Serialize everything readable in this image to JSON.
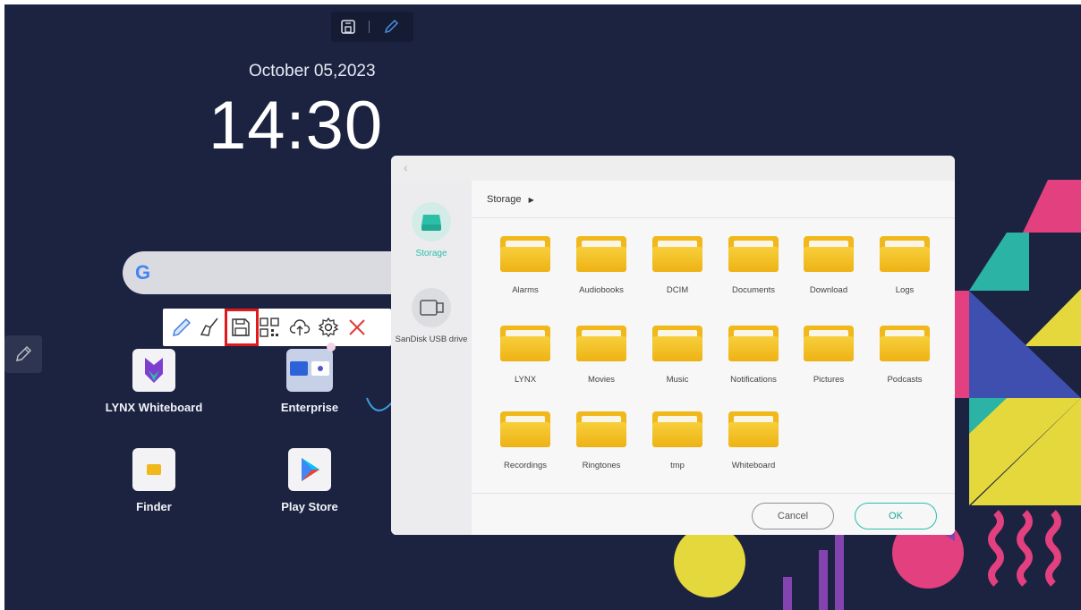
{
  "topbar": {
    "icons": [
      "save-panel-icon",
      "pen-icon"
    ]
  },
  "clock": {
    "date": "October 05,2023",
    "time": "14:30"
  },
  "search": {
    "logo": "G"
  },
  "toolbar": {
    "icons": [
      "pen-icon",
      "eraser-broom-icon",
      "save-icon",
      "qr-code-icon",
      "cloud-upload-icon",
      "settings-icon",
      "close-icon"
    ],
    "highlighted": "save-icon"
  },
  "apps": [
    {
      "label": "LYNX Whiteboard",
      "icon": "lynx-whiteboard-icon"
    },
    {
      "label": "Enterprise",
      "icon": "enterprise-folder-icon"
    },
    {
      "label": "Finder",
      "icon": "finder-icon"
    },
    {
      "label": "Play Store",
      "icon": "play-store-icon"
    }
  ],
  "dialog": {
    "back_glyph": "‹",
    "sidebar": [
      {
        "label": "Storage",
        "icon": "storage-drive-icon",
        "selected": true
      },
      {
        "label": "SanDisk USB drive",
        "icon": "usb-drive-icon",
        "selected": false
      }
    ],
    "breadcrumb": "Storage",
    "folders": [
      "Alarms",
      "Audiobooks",
      "DCIM",
      "Documents",
      "Download",
      "Logs",
      "LYNX",
      "Movies",
      "Music",
      "Notifications",
      "Pictures",
      "Podcasts",
      "Recordings",
      "Ringtones",
      "tmp",
      "Whiteboard"
    ],
    "cancel_label": "Cancel",
    "ok_label": "OK"
  },
  "colors": {
    "background": "#1c2340",
    "accent": "#2bbfa8",
    "folder": "#f0b81a",
    "highlight": "#e01a1a"
  }
}
